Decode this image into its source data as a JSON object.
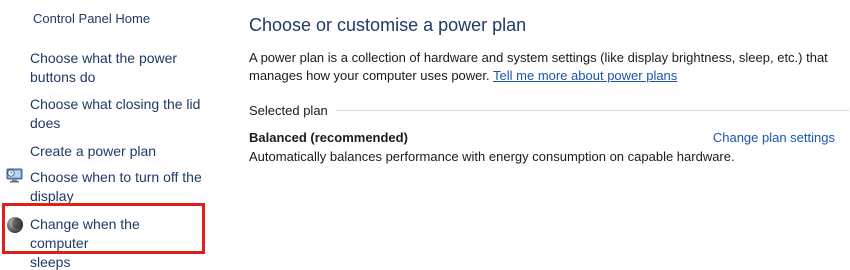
{
  "sidebar": {
    "home_label": "Control Panel Home",
    "items": [
      {
        "label_line1": "Choose what the power",
        "label_line2": "buttons do"
      },
      {
        "label_line1": "Choose what closing the lid",
        "label_line2": "does"
      },
      {
        "label_line1": "Create a power plan"
      },
      {
        "label_line1": "Choose when to turn off the",
        "label_line2": "display",
        "icon": "monitor-clock-icon"
      },
      {
        "label_line1": "Change when the computer",
        "label_line2": "sleeps",
        "icon": "moon-sleep-icon",
        "highlighted": true
      }
    ]
  },
  "main": {
    "title": "Choose or customise a power plan",
    "description": "A power plan is a collection of hardware and system settings (like display brightness, sleep, etc.) that manages how your computer uses power.",
    "description_link": "Tell me more about power plans",
    "selected_plan_label": "Selected plan",
    "plan": {
      "name": "Balanced (recommended)",
      "change_settings_label": "Change plan settings",
      "description": "Automatically balances performance with energy consumption on capable hardware."
    }
  },
  "colors": {
    "link": "#1a55b0",
    "nav_text": "#1e3a66",
    "highlight_border": "#e01e1e"
  }
}
